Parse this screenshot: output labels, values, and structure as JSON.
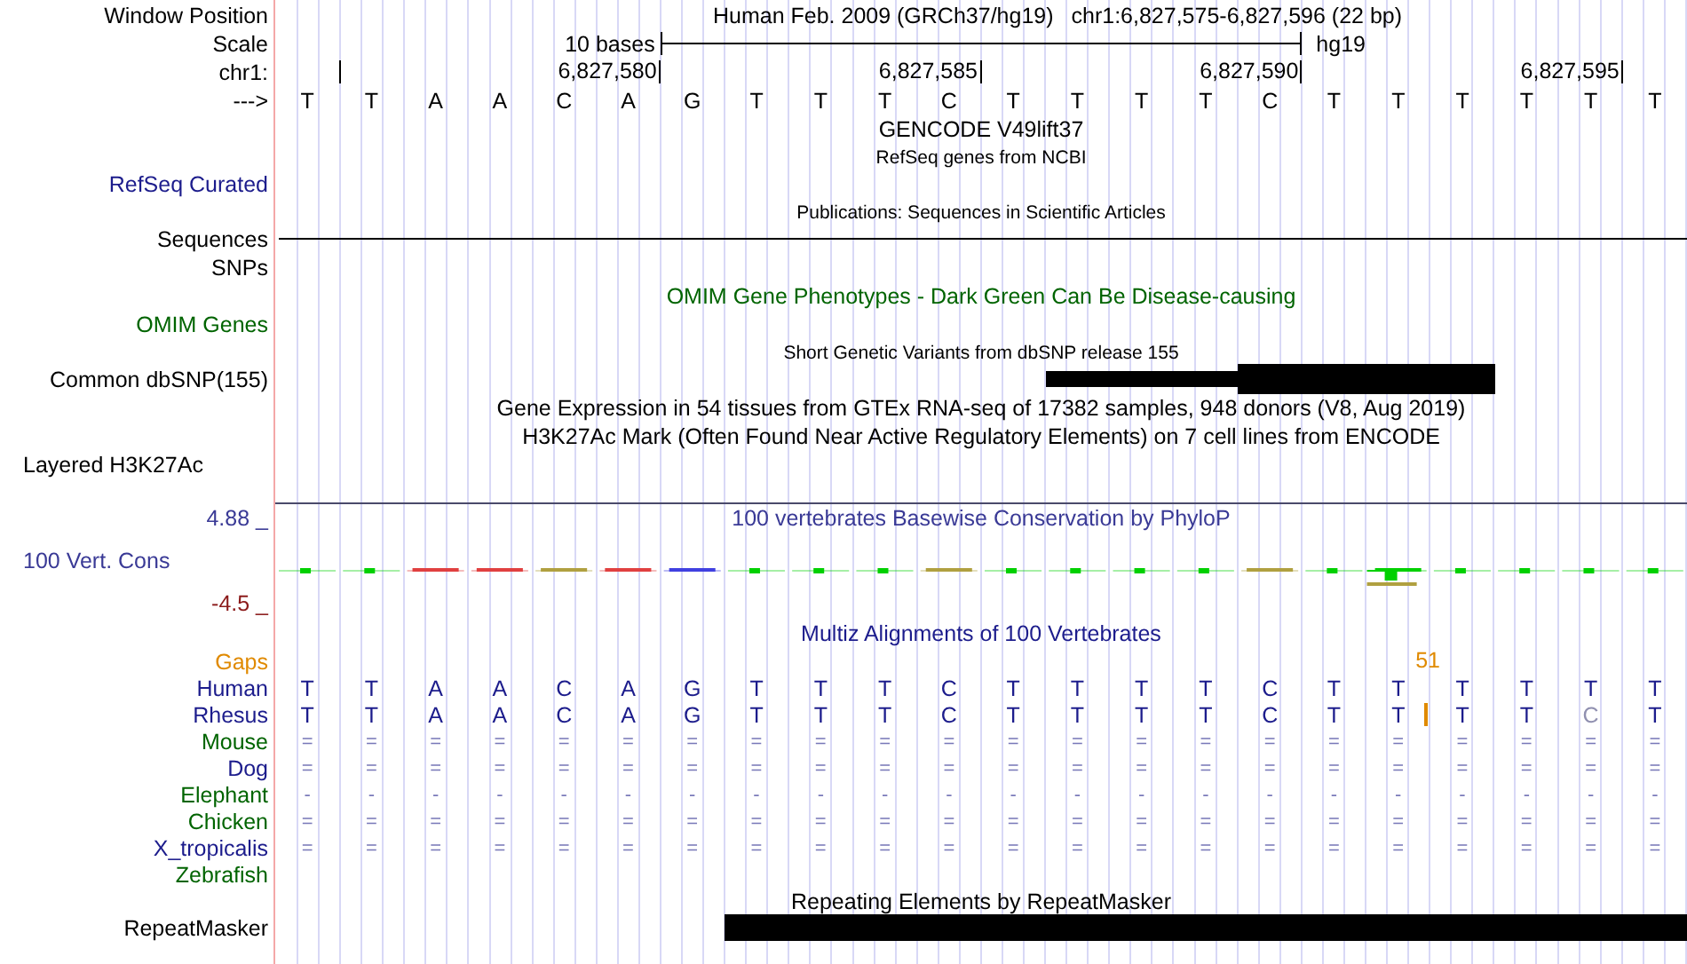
{
  "header": {
    "window_label": "Window Position",
    "assembly": "Human Feb. 2009 (GRCh37/hg19)",
    "position": "chr1:6,827,575-6,827,596 (22 bp)",
    "scale_label": "Scale",
    "scale_text": "10 bases",
    "scale_assembly": "hg19",
    "chrom_label": "chr1:",
    "ticks": [
      "6,827,580",
      "6,827,585",
      "6,827,590",
      "6,827,595"
    ],
    "strand_label": "--->",
    "bases": [
      "T",
      "T",
      "A",
      "A",
      "C",
      "A",
      "G",
      "T",
      "T",
      "T",
      "C",
      "T",
      "T",
      "T",
      "T",
      "C",
      "T",
      "T",
      "T",
      "T",
      "T",
      "T"
    ]
  },
  "tracks": [
    {
      "kind": "title",
      "text": "GENCODE V49lift37",
      "color": "#000000"
    },
    {
      "kind": "subtitle",
      "text": "RefSeq genes from NCBI",
      "color": "#000000"
    },
    {
      "kind": "label",
      "label": "RefSeq Curated",
      "color": "#1c1c8c"
    },
    {
      "kind": "subtitle",
      "text": "Publications: Sequences in Scientific Articles",
      "color": "#000000"
    },
    {
      "kind": "line",
      "label": "Sequences",
      "color": "#000000"
    },
    {
      "kind": "label",
      "label": "SNPs",
      "color": "#000000"
    },
    {
      "kind": "title",
      "text": "OMIM Gene Phenotypes - Dark Green Can Be Disease-causing",
      "color": "#006400"
    },
    {
      "kind": "label",
      "label": "OMIM Genes",
      "color": "#006400"
    },
    {
      "kind": "subtitle",
      "text": "Short Genetic Variants from dbSNP release 155",
      "color": "#000000"
    },
    {
      "kind": "dbsnp",
      "label": "Common dbSNP(155)",
      "color": "#000000"
    },
    {
      "kind": "title",
      "text": "Gene Expression in 54 tissues from GTEx RNA-seq of 17382 samples, 948 donors (V8, Aug 2019)",
      "color": "#000000"
    },
    {
      "kind": "title",
      "text": "H3K27Ac Mark (Often Found Near Active Regulatory Elements) on 7 cell lines from ENCODE",
      "color": "#000000"
    },
    {
      "kind": "layered",
      "label": "Layered H3K27Ac",
      "color": "#000000"
    }
  ],
  "conservation": {
    "max": "4.88 _",
    "title": "100 vertebrates Basewise Conservation by PhyloP",
    "label": "100 Vert. Cons",
    "min": "-4.5 _"
  },
  "multiz": {
    "title": "Multiz Alignments of 100 Vertebrates",
    "gaps_label": "Gaps",
    "gap_count": "51",
    "species": [
      {
        "name": "Human",
        "color": "#1c1c8c",
        "insertion": false,
        "bases": [
          "T",
          "T",
          "A",
          "A",
          "C",
          "A",
          "G",
          "T",
          "T",
          "T",
          "C",
          "T",
          "T",
          "T",
          "T",
          "C",
          "T",
          "T",
          "T",
          "T",
          "T",
          "T"
        ]
      },
      {
        "name": "Rhesus",
        "color": "#1c1c8c",
        "insertion": true,
        "bases": [
          "T",
          "T",
          "A",
          "A",
          "C",
          "A",
          "G",
          "T",
          "T",
          "T",
          "C",
          "T",
          "T",
          "T",
          "T",
          "C",
          "T",
          "T",
          "T",
          "T",
          "C",
          "T"
        ],
        "faded": [
          false,
          false,
          false,
          false,
          false,
          false,
          false,
          false,
          false,
          false,
          false,
          false,
          false,
          false,
          false,
          false,
          false,
          false,
          false,
          false,
          true,
          false
        ]
      },
      {
        "name": "Mouse",
        "color": "#006400",
        "insertion": false,
        "bases": [
          "=",
          "=",
          "=",
          "=",
          "=",
          "=",
          "=",
          "=",
          "=",
          "=",
          "=",
          "=",
          "=",
          "=",
          "=",
          "=",
          "=",
          "=",
          "=",
          "=",
          "=",
          "="
        ]
      },
      {
        "name": "Dog",
        "color": "#1c1c8c",
        "insertion": false,
        "bases": [
          "=",
          "=",
          "=",
          "=",
          "=",
          "=",
          "=",
          "=",
          "=",
          "=",
          "=",
          "=",
          "=",
          "=",
          "=",
          "=",
          "=",
          "=",
          "=",
          "=",
          "=",
          "="
        ]
      },
      {
        "name": "Elephant",
        "color": "#006400",
        "insertion": false,
        "bases": [
          "-",
          "-",
          "-",
          "-",
          "-",
          "-",
          "-",
          "-",
          "-",
          "-",
          "-",
          "-",
          "-",
          "-",
          "-",
          "-",
          "-",
          "-",
          "-",
          "-",
          "-",
          "-"
        ]
      },
      {
        "name": "Chicken",
        "color": "#006400",
        "insertion": false,
        "bases": [
          "=",
          "=",
          "=",
          "=",
          "=",
          "=",
          "=",
          "=",
          "=",
          "=",
          "=",
          "=",
          "=",
          "=",
          "=",
          "=",
          "=",
          "=",
          "=",
          "=",
          "=",
          "="
        ]
      },
      {
        "name": "X_tropicalis",
        "color": "#1c1c8c",
        "insertion": false,
        "bases": [
          "=",
          "=",
          "=",
          "=",
          "=",
          "=",
          "=",
          "=",
          "=",
          "=",
          "=",
          "=",
          "=",
          "=",
          "=",
          "=",
          "=",
          "=",
          "=",
          "=",
          "=",
          "="
        ]
      },
      {
        "name": "Zebrafish",
        "color": "#006400",
        "insertion": false
      }
    ]
  },
  "repeats": {
    "title": "Repeating Elements by RepeatMasker",
    "label": "RepeatMasker"
  }
}
